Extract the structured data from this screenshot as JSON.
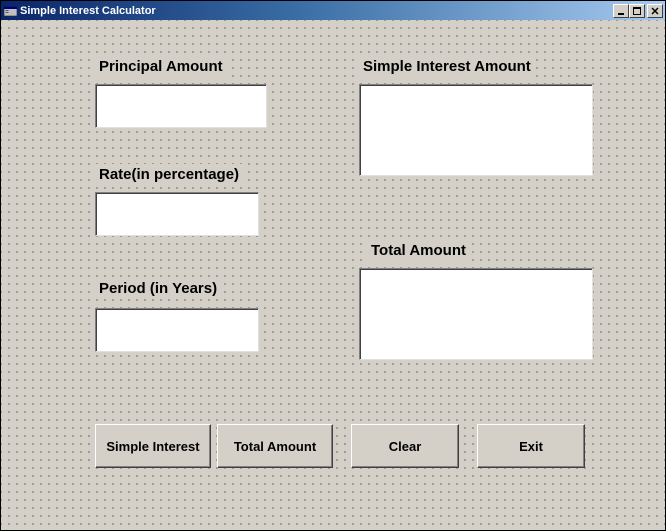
{
  "window": {
    "title": "Simple Interest Calculator"
  },
  "labels": {
    "principal": "Principal Amount",
    "rate": "Rate(in percentage)",
    "period": "Period (in Years)",
    "si": "Simple Interest Amount",
    "total": "Total Amount"
  },
  "fields": {
    "principal": "",
    "rate": "",
    "period": "",
    "si": "",
    "total": ""
  },
  "buttons": {
    "simple_interest": "Simple Interest",
    "total_amount": "Total Amount",
    "clear": "Clear",
    "exit": "Exit"
  }
}
